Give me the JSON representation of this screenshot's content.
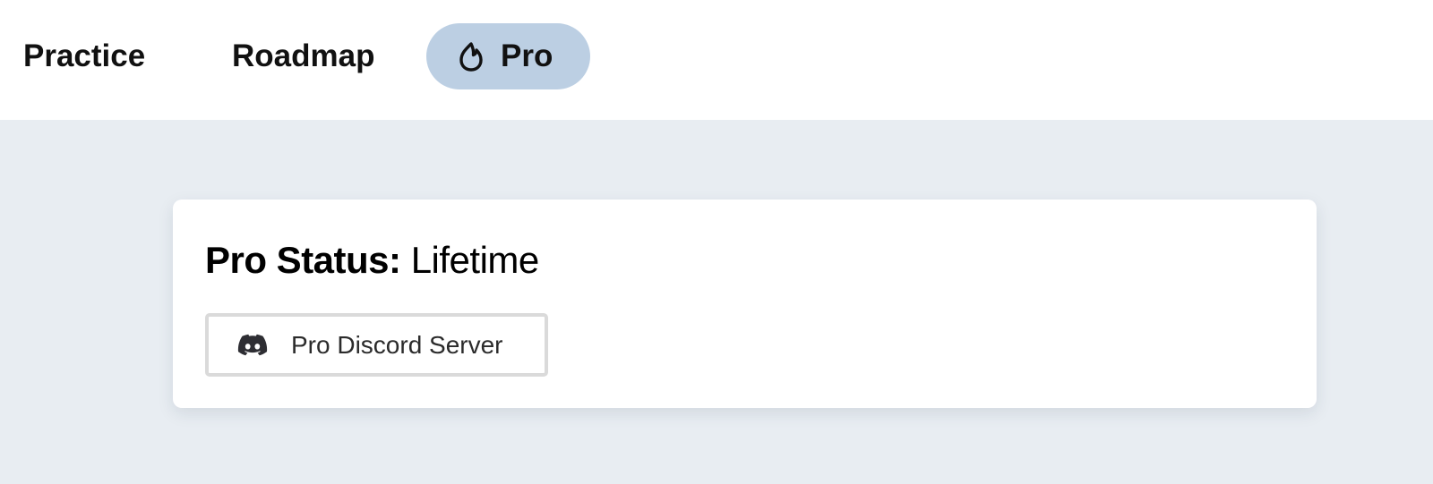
{
  "nav": {
    "items": [
      {
        "label": "Practice"
      },
      {
        "label": "Roadmap"
      },
      {
        "label": "Pro",
        "icon": "flame-icon",
        "active": true
      }
    ],
    "active_pill_color": "#bccfe3"
  },
  "card": {
    "status_label": "Pro Status:",
    "status_value": "Lifetime",
    "discord_button": {
      "label": "Pro Discord Server",
      "icon": "discord-icon"
    }
  },
  "colors": {
    "page_background": "#e8edf2",
    "header_background": "#ffffff",
    "card_background": "#ffffff",
    "button_border": "#dadada"
  }
}
